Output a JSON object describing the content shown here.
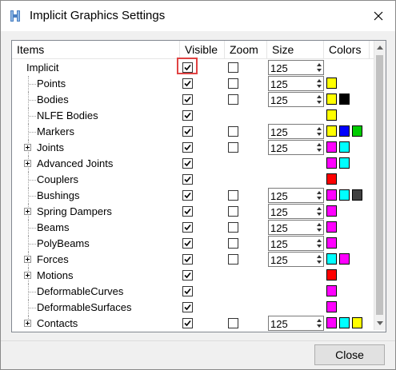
{
  "window": {
    "title": "Implicit Graphics Settings",
    "close_glyph": "✕"
  },
  "headers": {
    "items": "Items",
    "visible": "Visible",
    "zoom": "Zoom",
    "size": "Size",
    "colors": "Colors"
  },
  "colors": {
    "yellow": "#ffff00",
    "black": "#000000",
    "blue": "#0000ff",
    "green": "#00cc00",
    "magenta": "#ff00ff",
    "cyan": "#00ffff",
    "red": "#ff0000",
    "dark_gray": "#404040",
    "highlight": "#e04343"
  },
  "rows": [
    {
      "label": "Implicit",
      "level": 0,
      "expandable": false,
      "visible": true,
      "zoom": false,
      "size": "125",
      "swatches": [],
      "highlight_visible": true
    },
    {
      "label": "Points",
      "level": 1,
      "expandable": false,
      "visible": true,
      "zoom": false,
      "size": "125",
      "swatches": [
        "yellow"
      ]
    },
    {
      "label": "Bodies",
      "level": 1,
      "expandable": false,
      "visible": true,
      "zoom": false,
      "size": "125",
      "swatches": [
        "yellow",
        "black"
      ]
    },
    {
      "label": "NLFE Bodies",
      "level": 1,
      "expandable": false,
      "visible": true,
      "zoom": null,
      "size": null,
      "swatches": [
        "yellow"
      ]
    },
    {
      "label": "Markers",
      "level": 1,
      "expandable": false,
      "visible": true,
      "zoom": false,
      "size": "125",
      "swatches": [
        "yellow",
        "blue",
        "green"
      ]
    },
    {
      "label": "Joints",
      "level": 1,
      "expandable": true,
      "visible": true,
      "zoom": false,
      "size": "125",
      "swatches": [
        "magenta",
        "cyan"
      ]
    },
    {
      "label": "Advanced Joints",
      "level": 1,
      "expandable": true,
      "visible": true,
      "zoom": null,
      "size": null,
      "swatches": [
        "magenta",
        "cyan"
      ]
    },
    {
      "label": "Couplers",
      "level": 1,
      "expandable": false,
      "visible": true,
      "zoom": null,
      "size": null,
      "swatches": [
        "red"
      ]
    },
    {
      "label": "Bushings",
      "level": 1,
      "expandable": false,
      "visible": true,
      "zoom": false,
      "size": "125",
      "swatches": [
        "magenta",
        "cyan",
        "dark_gray"
      ]
    },
    {
      "label": "Spring Dampers",
      "level": 1,
      "expandable": true,
      "visible": true,
      "zoom": false,
      "size": "125",
      "swatches": [
        "magenta"
      ]
    },
    {
      "label": "Beams",
      "level": 1,
      "expandable": false,
      "visible": true,
      "zoom": false,
      "size": "125",
      "swatches": [
        "magenta"
      ]
    },
    {
      "label": "PolyBeams",
      "level": 1,
      "expandable": false,
      "visible": true,
      "zoom": false,
      "size": "125",
      "swatches": [
        "magenta"
      ]
    },
    {
      "label": "Forces",
      "level": 1,
      "expandable": true,
      "visible": true,
      "zoom": false,
      "size": "125",
      "swatches": [
        "cyan",
        "magenta"
      ]
    },
    {
      "label": "Motions",
      "level": 1,
      "expandable": true,
      "visible": true,
      "zoom": null,
      "size": null,
      "swatches": [
        "red"
      ]
    },
    {
      "label": "DeformableCurves",
      "level": 1,
      "expandable": false,
      "visible": true,
      "zoom": null,
      "size": null,
      "swatches": [
        "magenta"
      ]
    },
    {
      "label": "DeformableSurfaces",
      "level": 1,
      "expandable": false,
      "visible": true,
      "zoom": null,
      "size": null,
      "swatches": [
        "magenta"
      ]
    },
    {
      "label": "Contacts",
      "level": 1,
      "expandable": true,
      "visible": true,
      "zoom": false,
      "size": "125",
      "swatches": [
        "magenta",
        "cyan",
        "yellow"
      ]
    }
  ],
  "buttons": {
    "close": "Close"
  }
}
